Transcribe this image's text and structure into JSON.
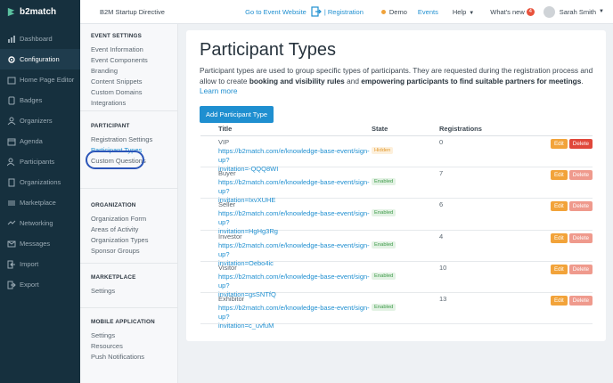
{
  "topbar": {
    "brand": "b2match",
    "event_name": "B2M Startup Directive",
    "goto_label": "Go to Event Website",
    "registration_label": "| Registration",
    "demo_label": "Demo",
    "events_label": "Events",
    "help_label": "Help",
    "whats_new_label": "What's new",
    "whats_new_count": "4",
    "user_name": "Sarah Smith"
  },
  "nav": [
    {
      "label": "Dashboard",
      "icon": "dashboard-icon"
    },
    {
      "label": "Configuration",
      "icon": "configuration-icon"
    },
    {
      "label": "Home Page Editor",
      "icon": "home-page-editor-icon"
    },
    {
      "label": "Badges",
      "icon": "badges-icon"
    },
    {
      "label": "Organizers",
      "icon": "organizers-icon"
    },
    {
      "label": "Agenda",
      "icon": "agenda-icon"
    },
    {
      "label": "Participants",
      "icon": "participants-icon"
    },
    {
      "label": "Organizations",
      "icon": "organizations-icon"
    },
    {
      "label": "Marketplace",
      "icon": "marketplace-icon"
    },
    {
      "label": "Networking",
      "icon": "networking-icon"
    },
    {
      "label": "Messages",
      "icon": "messages-icon"
    },
    {
      "label": "Import",
      "icon": "import-icon"
    },
    {
      "label": "Export",
      "icon": "export-icon"
    }
  ],
  "submenu": {
    "event_settings": {
      "title": "EVENT SETTINGS",
      "items": [
        "Event Information",
        "Event Components",
        "Branding",
        "Content Snippets",
        "Custom Domains",
        "Integrations"
      ]
    },
    "participant": {
      "title": "PARTICIPANT",
      "items": [
        "Registration Settings",
        "Participant Types",
        "Custom Questions"
      ]
    },
    "organization": {
      "title": "ORGANIZATION",
      "items": [
        "Organization Form",
        "Areas of Activity",
        "Organization Types",
        "Sponsor Groups"
      ]
    },
    "marketplace": {
      "title": "MARKETPLACE",
      "items": [
        "Settings"
      ]
    },
    "mobile": {
      "title": "MOBILE APPLICATION",
      "items": [
        "Settings",
        "Resources",
        "Push Notifications"
      ]
    }
  },
  "main": {
    "title": "Participant Types",
    "desc_part1": "Participant types are used to group specific types of participants. They are requested during the registration process and allow to create ",
    "desc_bold1": "booking and visibility rules",
    "desc_part2": " and ",
    "desc_bold2": "empowering participants to find suitable partners for meetings",
    "desc_part3": ". ",
    "learn_more": "Learn more",
    "add_button": "Add Participant Type",
    "columns": {
      "title": "Title",
      "state": "State",
      "registrations": "Registrations"
    },
    "edit_label": "Edit",
    "delete_label": "Delete",
    "rows": [
      {
        "name": "VIP",
        "link1": "https://b2match.com/e/knowledge-base-event/sign-up?",
        "link2": "invitation=-QQQ8WI",
        "state": "Hidden",
        "registrations": "0"
      },
      {
        "name": "Buyer",
        "link1": "https://b2match.com/e/knowledge-base-event/sign-up?",
        "link2": "invitation=IxvXUHE",
        "state": "Enabled",
        "registrations": "7"
      },
      {
        "name": "Seller",
        "link1": "https://b2match.com/e/knowledge-base-event/sign-up?",
        "link2": "invitation=HgHg3Rg",
        "state": "Enabled",
        "registrations": "6"
      },
      {
        "name": "Investor",
        "link1": "https://b2match.com/e/knowledge-base-event/sign-up?",
        "link2": "invitation=Oebo4ic",
        "state": "Enabled",
        "registrations": "4"
      },
      {
        "name": "Visitor",
        "link1": "https://b2match.com/e/knowledge-base-event/sign-up?",
        "link2": "invitation=gsSNTfQ",
        "state": "Enabled",
        "registrations": "10"
      },
      {
        "name": "Exhibitor",
        "link1": "https://b2match.com/e/knowledge-base-event/sign-up?",
        "link2": "invitation=c_uvfuM",
        "state": "Enabled",
        "registrations": "13"
      }
    ]
  },
  "colors": {
    "accent": "#1f8fd0",
    "sidebar": "#16303e",
    "edit": "#f2a33a",
    "delete": "#e0473a",
    "highlight": "#2b55b8"
  }
}
